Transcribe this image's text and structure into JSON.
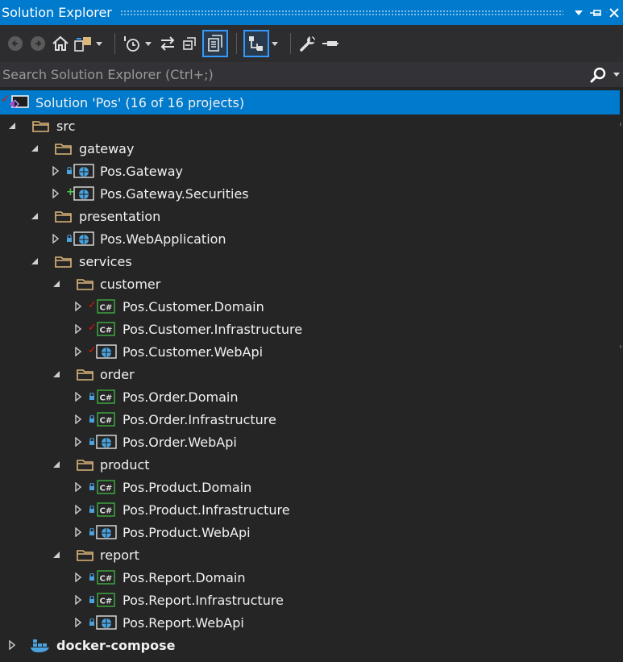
{
  "window": {
    "title": "Solution Explorer"
  },
  "search": {
    "placeholder": "Search Solution Explorer (Ctrl+;)"
  },
  "solution": {
    "label": "Solution 'Pos' (16 of 16 projects)"
  },
  "tree": {
    "src": "src",
    "gateway": "gateway",
    "pos_gateway": "Pos.Gateway",
    "pos_gateway_securities": "Pos.Gateway.Securities",
    "presentation": "presentation",
    "pos_webapplication": "Pos.WebApplication",
    "services": "services",
    "customer": "customer",
    "customer_domain": "Pos.Customer.Domain",
    "customer_infra": "Pos.Customer.Infrastructure",
    "customer_webapi": "Pos.Customer.WebApi",
    "order": "order",
    "order_domain": "Pos.Order.Domain",
    "order_infra": "Pos.Order.Infrastructure",
    "order_webapi": "Pos.Order.WebApi",
    "product": "product",
    "product_domain": "Pos.Product.Domain",
    "product_infra": "Pos.Product.Infrastructure",
    "product_webapi": "Pos.Product.WebApi",
    "report": "report",
    "report_domain": "Pos.Report.Domain",
    "report_infra": "Pos.Report.Infrastructure",
    "report_webapi": "Pos.Report.WebApi",
    "docker_compose": "docker-compose"
  },
  "icons": {
    "csharp": "C#",
    "colors": {
      "accent": "#007acc",
      "csharp": "#3fae3f",
      "lock": "#4aa3df",
      "check": "#e51400",
      "add": "#4ec94e",
      "folder": "#dcb67a",
      "globe": "#4aa3df"
    }
  }
}
